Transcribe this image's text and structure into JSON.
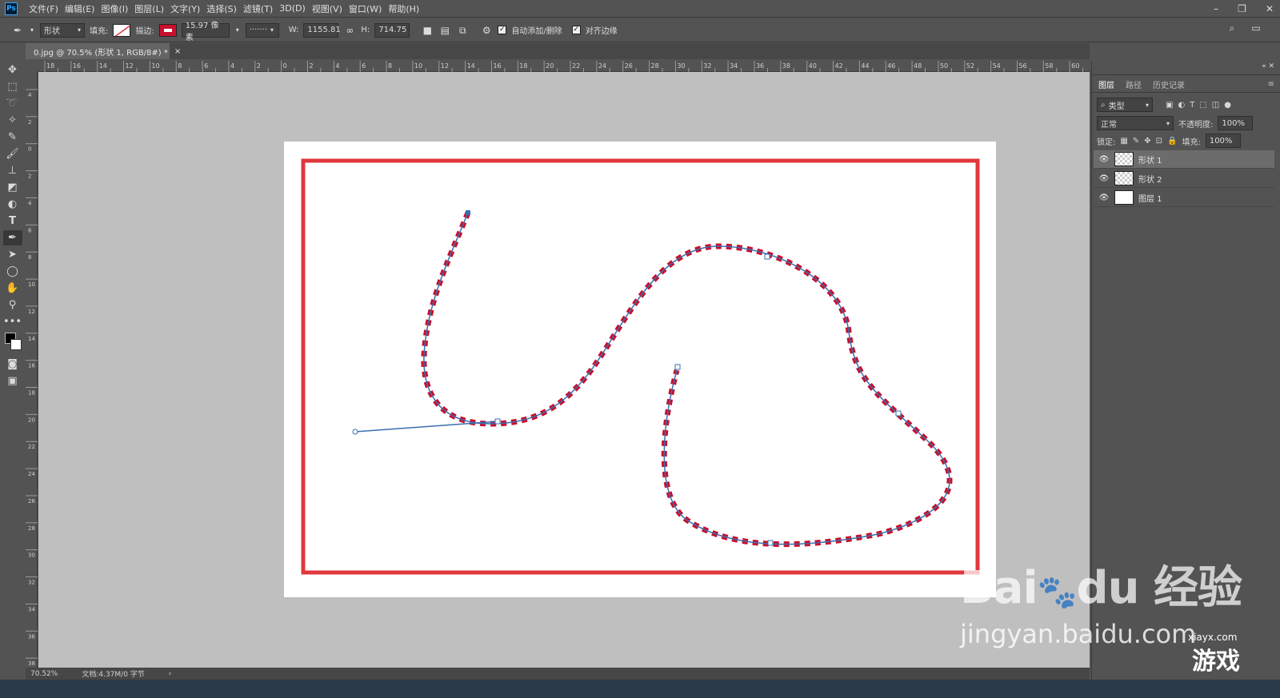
{
  "menu": {
    "logo": "Ps",
    "items": [
      "文件(F)",
      "编辑(E)",
      "图像(I)",
      "图层(L)",
      "文字(Y)",
      "选择(S)",
      "滤镜(T)",
      "3D(D)",
      "视图(V)",
      "窗口(W)",
      "帮助(H)"
    ]
  },
  "options": {
    "mode": "形状",
    "fill_label": "填充:",
    "stroke_label": "描边:",
    "stroke_size": "15.97 像素",
    "w_label": "W:",
    "w_value": "1155.81",
    "h_label": "H:",
    "h_value": "714.75",
    "auto_add_label": "自动添加/删除",
    "align_edges_label": "对齐边缘"
  },
  "document": {
    "tab_title": "0.jpg @ 70.5% (形状 1, RGB/8#) *",
    "zoom": "70.52%",
    "doc_info": "文档:4.37M/0 字节",
    "frame_color": "#e0383d",
    "stroke_color": "#c8102e",
    "path_color": "#3a6fb0"
  },
  "ruler": {
    "h_labels": [
      "18",
      "16",
      "14",
      "12",
      "10",
      "8",
      "6",
      "4",
      "2",
      "0",
      "2",
      "4",
      "6",
      "8",
      "10",
      "12",
      "14",
      "16",
      "18",
      "20",
      "22",
      "24",
      "26",
      "28",
      "30",
      "32",
      "34",
      "36",
      "38",
      "40",
      "42",
      "44",
      "46",
      "48",
      "50",
      "52",
      "54",
      "56",
      "58",
      "60"
    ],
    "v_labels": [
      "4",
      "2",
      "0",
      "2",
      "4",
      "6",
      "8",
      "10",
      "12",
      "14",
      "16",
      "18",
      "20",
      "22",
      "24",
      "26",
      "28",
      "30",
      "32",
      "34",
      "36",
      "38"
    ]
  },
  "panel": {
    "tabs": [
      "图层",
      "路径",
      "历史记录"
    ],
    "filter_label": "类型",
    "blend_mode": "正常",
    "opacity_label": "不透明度:",
    "opacity_value": "100%",
    "lock_label": "锁定:",
    "fill_label": "填充:",
    "fill_value": "100%",
    "layers": [
      {
        "name": "形状 1",
        "selected": true
      },
      {
        "name": "形状 2",
        "selected": false
      },
      {
        "name": "图层 1",
        "selected": false
      }
    ]
  },
  "watermark": {
    "brand": "Bai",
    "brand2": "du",
    "cn": "经验",
    "url": "jingyan.baidu.com",
    "site": "xiayx.com",
    "game": "游戏"
  }
}
